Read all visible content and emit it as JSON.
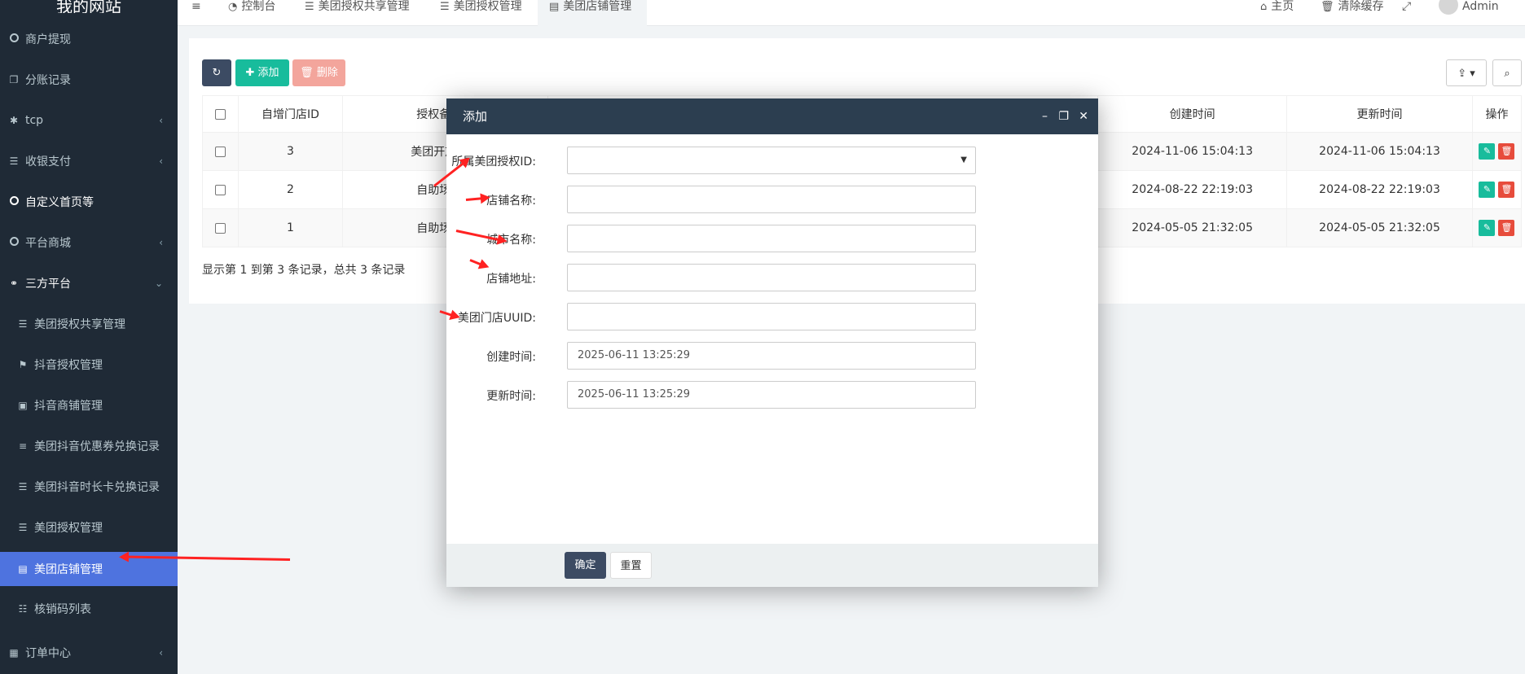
{
  "sidebar": {
    "logo": "我的网站",
    "items": [
      {
        "label": "商户提现",
        "icon": "circle-icon"
      },
      {
        "label": "分账记录",
        "icon": "copy-icon"
      },
      {
        "label": "tcp",
        "icon": "asterisk-icon"
      },
      {
        "label": "收银支付",
        "icon": "list-icon"
      },
      {
        "label": "自定义首页等",
        "icon": "circle-icon"
      },
      {
        "label": "平台商城",
        "icon": "circle-icon"
      },
      {
        "label": "三方平台",
        "icon": "handshake-icon"
      },
      {
        "label": "美团授权共享管理",
        "icon": "list-icon"
      },
      {
        "label": "抖音授权管理",
        "icon": "flag-icon"
      },
      {
        "label": "抖音商铺管理",
        "icon": "archive-icon"
      },
      {
        "label": "美团抖音优惠券兑换记录",
        "icon": "bars-icon"
      },
      {
        "label": "美团抖音时长卡兑换记录",
        "icon": "indent-icon"
      },
      {
        "label": "美团授权管理",
        "icon": "list-icon"
      },
      {
        "label": "美团店铺管理",
        "icon": "book-icon"
      },
      {
        "label": "核销码列表",
        "icon": "list-ol-icon"
      },
      {
        "label": "订单中心",
        "icon": "list-alt-icon"
      }
    ]
  },
  "topbar": {
    "menu_icon": "≡",
    "tabs": [
      "控制台",
      "美团授权共享管理",
      "美团授权管理",
      "美团店铺管理"
    ],
    "home": "主页",
    "clear_cache": "清除缓存",
    "user": "Admin"
  },
  "toolbar": {
    "add": "添加",
    "delete": "删除"
  },
  "table": {
    "headers": [
      "自增门店ID",
      "授权备注名",
      "创建时间",
      "更新时间",
      "操作"
    ],
    "rows": [
      {
        "id": "3",
        "name": "美团开放平台",
        "created": "2024-11-06 15:04:13",
        "updated": "2024-11-06 15:04:13"
      },
      {
        "id": "2",
        "name": "自助场地预",
        "created": "2024-08-22 22:19:03",
        "updated": "2024-08-22 22:19:03"
      },
      {
        "id": "1",
        "name": "自助场地预",
        "created": "2024-05-05 21:32:05",
        "updated": "2024-05-05 21:32:05"
      }
    ],
    "pager": "显示第 1 到第 3 条记录，总共 3 条记录"
  },
  "modal": {
    "title": "添加",
    "fields": [
      {
        "label": "所属美团授权ID:",
        "value": ""
      },
      {
        "label": "店铺名称:",
        "value": ""
      },
      {
        "label": "城市名称:",
        "value": ""
      },
      {
        "label": "店铺地址:",
        "value": ""
      },
      {
        "label": "美团门店UUID:",
        "value": ""
      },
      {
        "label": "创建时间:",
        "value": "2025-06-11 13:25:29"
      },
      {
        "label": "更新时间:",
        "value": "2025-06-11 13:25:29"
      }
    ],
    "confirm": "确定",
    "reset": "重置"
  },
  "colors": {
    "sidebar_bg": "#1f2a36",
    "active": "#4e73df",
    "primary": "#18bc9c",
    "danger": "#e74c3c",
    "modal_head": "#2c3e50",
    "annotation_arrow": "#ff2222"
  }
}
